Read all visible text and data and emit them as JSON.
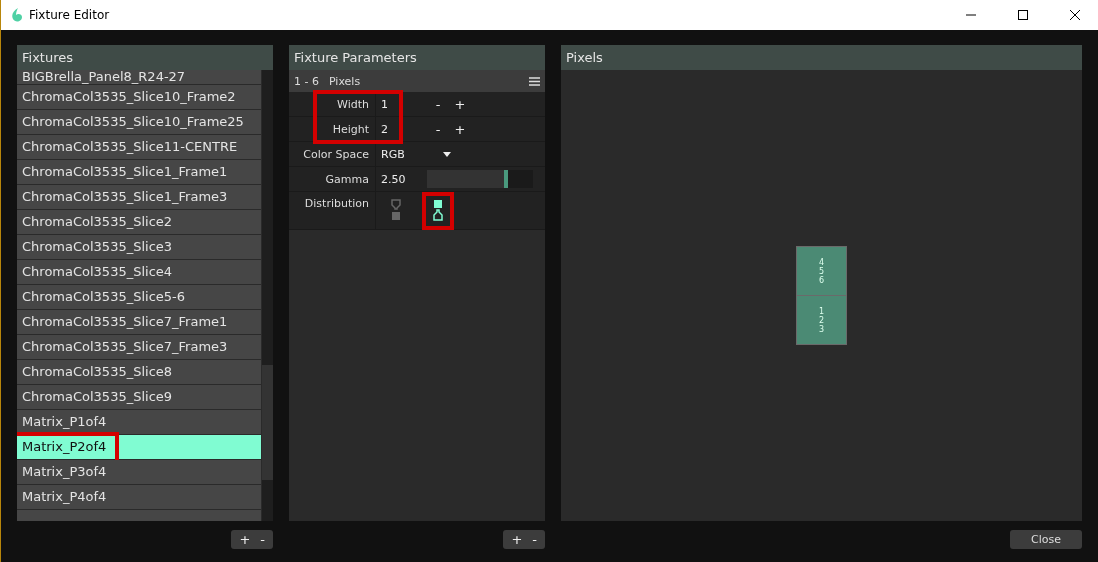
{
  "window": {
    "title": "Fixture Editor"
  },
  "fixtures": {
    "title": "Fixtures",
    "items": [
      {
        "label": "BIGBrella_Panel8_R24-27",
        "selected": false,
        "highlighted": false,
        "partial": true
      },
      {
        "label": "ChromaCol3535_Slice10_Frame2",
        "selected": false,
        "highlighted": false
      },
      {
        "label": "ChromaCol3535_Slice10_Frame25",
        "selected": false,
        "highlighted": false
      },
      {
        "label": "ChromaCol3535_Slice11-CENTRE",
        "selected": false,
        "highlighted": false
      },
      {
        "label": "ChromaCol3535_Slice1_Frame1",
        "selected": false,
        "highlighted": false
      },
      {
        "label": "ChromaCol3535_Slice1_Frame3",
        "selected": false,
        "highlighted": false
      },
      {
        "label": "ChromaCol3535_Slice2",
        "selected": false,
        "highlighted": false
      },
      {
        "label": "ChromaCol3535_Slice3",
        "selected": false,
        "highlighted": false
      },
      {
        "label": "ChromaCol3535_Slice4",
        "selected": false,
        "highlighted": false
      },
      {
        "label": "ChromaCol3535_Slice5-6",
        "selected": false,
        "highlighted": false
      },
      {
        "label": "ChromaCol3535_Slice7_Frame1",
        "selected": false,
        "highlighted": false
      },
      {
        "label": "ChromaCol3535_Slice7_Frame3",
        "selected": false,
        "highlighted": false
      },
      {
        "label": "ChromaCol3535_Slice8",
        "selected": false,
        "highlighted": false
      },
      {
        "label": "ChromaCol3535_Slice9",
        "selected": false,
        "highlighted": false
      },
      {
        "label": "Matrix_P1of4",
        "selected": false,
        "highlighted": false
      },
      {
        "label": "Matrix_P2of4",
        "selected": true,
        "highlighted": true
      },
      {
        "label": "Matrix_P3of4",
        "selected": false,
        "highlighted": false
      },
      {
        "label": "Matrix_P4of4",
        "selected": false,
        "highlighted": false
      }
    ],
    "buttons": [
      "+",
      "-"
    ]
  },
  "parameters": {
    "title": "Fixture Parameters",
    "section": {
      "range": "1 - 6",
      "name": "Pixels"
    },
    "size": {
      "highlighted": true,
      "rows": [
        {
          "label": "Width",
          "value": "1",
          "buttons": [
            "-",
            "+"
          ]
        },
        {
          "label": "Height",
          "value": "2",
          "buttons": [
            "-",
            "+"
          ]
        }
      ]
    },
    "color_space": {
      "label": "Color Space",
      "value": "RGB"
    },
    "gamma": {
      "label": "Gamma",
      "value": "2.50",
      "level": 0.76
    },
    "distribution": {
      "label": "Distribution",
      "options": [
        {
          "selected": false,
          "highlighted": false
        },
        {
          "selected": true,
          "highlighted": true
        }
      ]
    },
    "buttons": [
      "+",
      "-"
    ]
  },
  "pixels": {
    "title": "Pixels",
    "cells": [
      {
        "lines": [
          "4",
          "5",
          "6"
        ]
      },
      {
        "lines": [
          "1",
          "2",
          "3"
        ]
      }
    ]
  },
  "close_button": "Close"
}
